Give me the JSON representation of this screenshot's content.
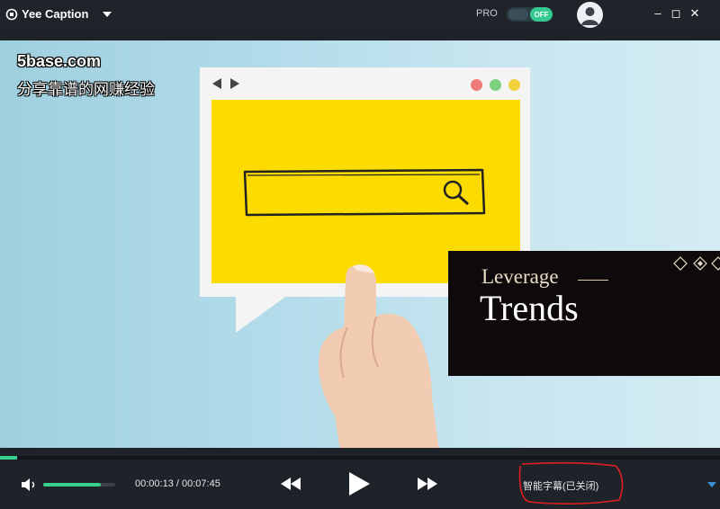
{
  "app": {
    "title": "Yee Caption",
    "pro_label": "PRO",
    "toggle_label": "OFF"
  },
  "window_controls": {
    "minimize": "–",
    "maximize": "◻",
    "close": "✕"
  },
  "video": {
    "watermark_url": "5base.com",
    "watermark_text": "分享靠谱的网赚经验",
    "overlay_small": "Leverage",
    "overlay_big": "Trends"
  },
  "player": {
    "progress_fraction": 0.024,
    "volume_fraction": 0.8,
    "current_time": "00:00:13",
    "total_time": "00:07:45",
    "time_display": "00:00:13 / 00:07:45",
    "caption_toggle_label": "智能字幕(已关闭)"
  },
  "icons": {
    "app": "logo-icon",
    "dropdown": "chevron-down-icon",
    "avatar": "user-avatar-icon",
    "volume": "speaker-icon",
    "rewind": "rewind-icon",
    "play": "play-icon",
    "forward": "fast-forward-icon",
    "more": "triangle-down-icon"
  },
  "colors": {
    "accent": "#35d08e",
    "titlebar": "#1f242a",
    "controls_bg": "#1e2329",
    "annotation": "#e02020"
  }
}
